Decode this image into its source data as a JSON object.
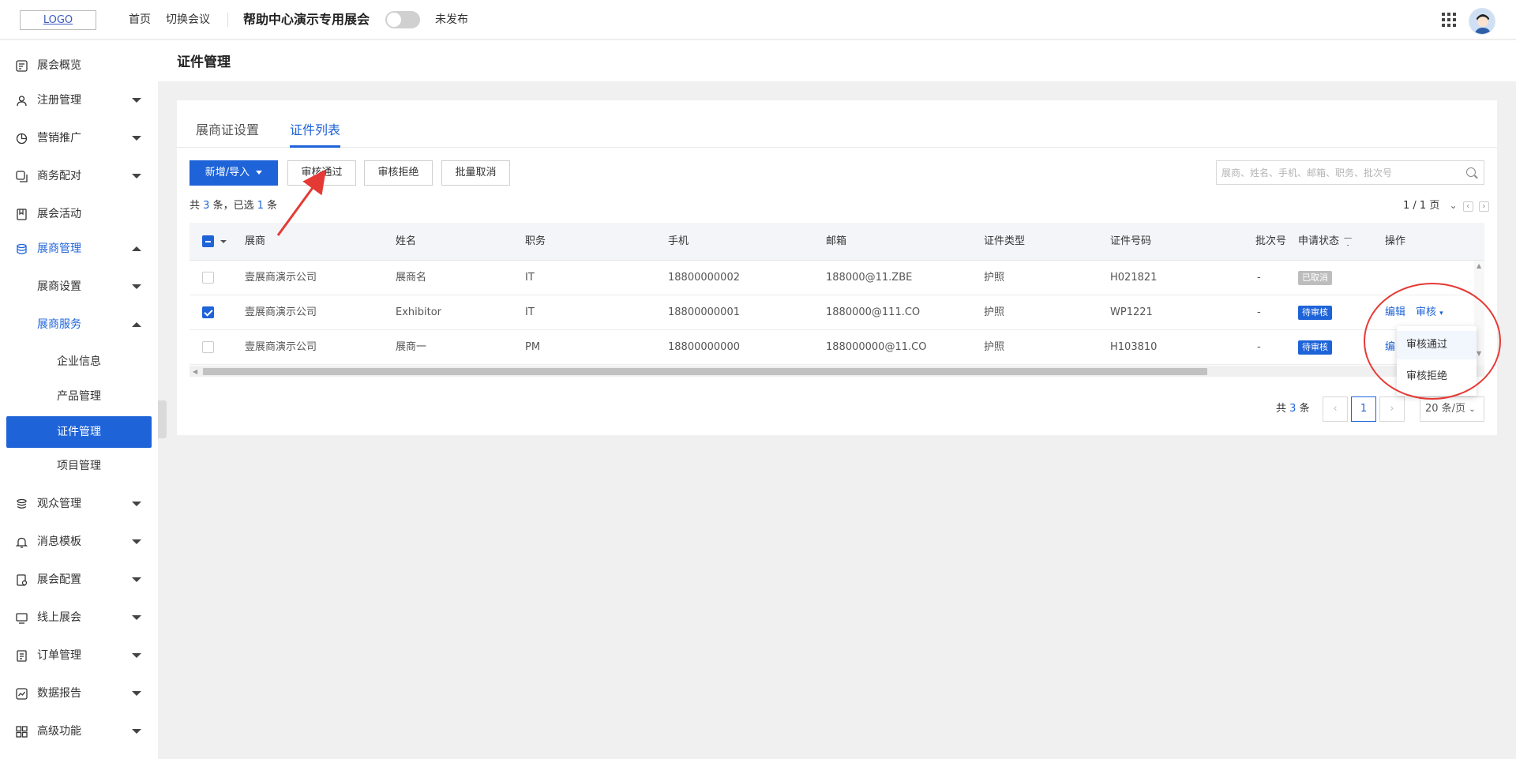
{
  "header": {
    "logo": "LOGO",
    "nav_home": "首页",
    "nav_switch": "切换会议",
    "expo_title": "帮助中心演示专用展会",
    "publish_status": "未发布"
  },
  "sidebar": {
    "items": [
      {
        "label": "展会概览",
        "icon": "overview-icon"
      },
      {
        "label": "注册管理",
        "icon": "user-icon"
      },
      {
        "label": "营销推广",
        "icon": "chart-pie-icon"
      },
      {
        "label": "商务配对",
        "icon": "match-icon"
      },
      {
        "label": "展会活动",
        "icon": "bookmark-icon"
      },
      {
        "label": "展商管理",
        "icon": "database-icon"
      },
      {
        "label": "展商设置"
      },
      {
        "label": "展商服务"
      },
      {
        "label": "企业信息"
      },
      {
        "label": "产品管理"
      },
      {
        "label": "证件管理"
      },
      {
        "label": "项目管理"
      },
      {
        "label": "观众管理",
        "icon": "layers-icon"
      },
      {
        "label": "消息模板",
        "icon": "bell-icon"
      },
      {
        "label": "展会配置",
        "icon": "config-icon"
      },
      {
        "label": "线上展会",
        "icon": "monitor-icon"
      },
      {
        "label": "订单管理",
        "icon": "order-icon"
      },
      {
        "label": "数据报告",
        "icon": "report-icon"
      },
      {
        "label": "高级功能",
        "icon": "grid-icon"
      }
    ]
  },
  "page": {
    "title": "证件管理"
  },
  "tabs": [
    "展商证设置",
    "证件列表"
  ],
  "toolbar": {
    "add_import": "新增/导入",
    "approve": "审核通过",
    "reject": "审核拒绝",
    "batch_cancel": "批量取消",
    "search_placeholder": "展商、姓名、手机、邮箱、职务、批次号"
  },
  "summary": {
    "prefix": "共",
    "total": "3",
    "mid": "条，已选",
    "selected": "1",
    "suffix": "条",
    "page_info": "1 / 1 页"
  },
  "table": {
    "columns": [
      "展商",
      "姓名",
      "职务",
      "手机",
      "邮箱",
      "证件类型",
      "证件号码",
      "批次号",
      "申请状态",
      "操作"
    ],
    "rows": [
      {
        "exhibitor": "壹展商演示公司",
        "name": "展商名",
        "title": "IT",
        "phone": "18800000002",
        "email": "188000@11.ZBE",
        "cert_type": "护照",
        "cert_no": "H021821",
        "batch": "-",
        "status": "已取消",
        "checked": false
      },
      {
        "exhibitor": "壹展商演示公司",
        "name": "Exhibitor",
        "title": "IT",
        "phone": "18800000001",
        "email": "1880000@111.CO",
        "cert_type": "护照",
        "cert_no": "WP1221",
        "batch": "-",
        "status": "待审核",
        "checked": true,
        "edit": "编辑",
        "review": "审核"
      },
      {
        "exhibitor": "壹展商演示公司",
        "name": "展商一",
        "title": "PM",
        "phone": "18800000000",
        "email": "188000000@11.CO",
        "cert_type": "护照",
        "cert_no": "H103810",
        "batch": "-",
        "status": "待审核",
        "checked": false,
        "edit": "编"
      }
    ]
  },
  "dropdown": {
    "items": [
      "审核通过",
      "审核拒绝"
    ]
  },
  "pager": {
    "prefix": "共",
    "total": "3",
    "suffix": "条",
    "current": "1",
    "page_size": "20 条/页"
  },
  "colors": {
    "primary": "#1e63d8",
    "annotation": "#e53935"
  }
}
